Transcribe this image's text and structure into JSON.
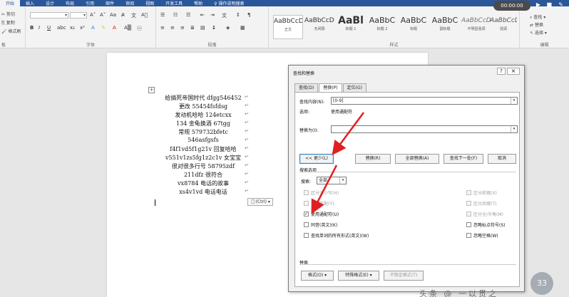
{
  "ribbon": {
    "tabs": [
      "开始",
      "插入",
      "设计",
      "布局",
      "引用",
      "邮件",
      "审阅",
      "视图",
      "开发工具",
      "帮助",
      "操作说明搜索"
    ],
    "active_tab": "开始",
    "timer": "00:00:00",
    "clipboard": {
      "cut": "剪切",
      "copy": "复制",
      "painter": "格式刷",
      "label": "板"
    },
    "font_group_label": "字体",
    "paragraph_group_label": "段落",
    "styles_group_label": "样式",
    "editing_group_label": "编辑",
    "styles": [
      {
        "preview": "AaBbCcDt",
        "name": "正文"
      },
      {
        "preview": "AaBbCcDt",
        "name": "无间隔"
      },
      {
        "preview": "AaBl",
        "name": "标题 1"
      },
      {
        "preview": "AaBbC",
        "name": "标题 2"
      },
      {
        "preview": "AaBbC",
        "name": "标题"
      },
      {
        "preview": "AaBbC",
        "name": "副标题"
      },
      {
        "preview": "AaBbCcDt",
        "name": "不明显强调"
      },
      {
        "preview": "AaBbCcDt",
        "name": "强调"
      }
    ],
    "editing": {
      "find": "查找",
      "replace": "替换",
      "select": "选择"
    }
  },
  "document": {
    "lines": [
      "给搞死帝国时代 dfgg546452",
      "更改 55454fsfdsg",
      "发动机哈哈 124etcxx",
      "134 金龟换酒 67tgg",
      "常规 579732bfetc",
      "546asfgsfs",
      "f4f1vd5f1g21v 回复哈哈",
      "v551v1zs5fg1z2c1v 女宝宝",
      "很对很多行号 58795zdf",
      "211dfz 很符合",
      "vx8784 电话的故事",
      "xs4v1vd 电话电话"
    ],
    "paste_options": "(Ctrl)"
  },
  "dialog": {
    "title": "查找和替换",
    "help": "?",
    "close": "×",
    "tabs": [
      "查找(D)",
      "替换(P)",
      "定位(G)"
    ],
    "find_label": "查找内容(N):",
    "find_value": "[0-9]",
    "options_label": "选项:",
    "options_value": "使用通配符",
    "replace_label": "替换为(I):",
    "replace_value": "",
    "buttons": {
      "less": "<< 更少(L)",
      "replace": "替换(R)",
      "replace_all": "全部替换(A)",
      "find_next": "查找下一处(F)",
      "cancel": "取消"
    },
    "search_options_title": "搜索选项",
    "search_label": "搜索:",
    "search_value": "全部",
    "left_checks": [
      {
        "label": "区分大小写(H)",
        "checked": false,
        "disabled": true
      },
      {
        "label": "全字匹配(Y)",
        "checked": false,
        "disabled": true
      },
      {
        "label": "使用通配符(U)",
        "checked": true,
        "disabled": false
      },
      {
        "label": "同音(英文)(K)",
        "checked": false,
        "disabled": false
      },
      {
        "label": "查找单词的所有形式(英文)(W)",
        "checked": false,
        "disabled": false
      }
    ],
    "right_checks": [
      {
        "label": "区分前缀(X)",
        "checked": false,
        "disabled": true
      },
      {
        "label": "区分后缀(T)",
        "checked": false,
        "disabled": true
      },
      {
        "label": "区分全/半角(M)",
        "checked": false,
        "disabled": true
      },
      {
        "label": "忽略标点符号(S)",
        "checked": false,
        "disabled": false
      },
      {
        "label": "忽略空格(W)",
        "checked": false,
        "disabled": false
      }
    ],
    "replace_section_title": "替换",
    "bottom_buttons": {
      "format": "格式(O) ▾",
      "special": "特殊格式(E) ▾",
      "no_format": "不限定格式(T)"
    }
  },
  "overlay": {
    "badge": "33",
    "watermark": "头条 @ 一以贯之"
  },
  "colors": {
    "ribbon_blue": "#2b579a",
    "arrow_red": "#e02020"
  }
}
